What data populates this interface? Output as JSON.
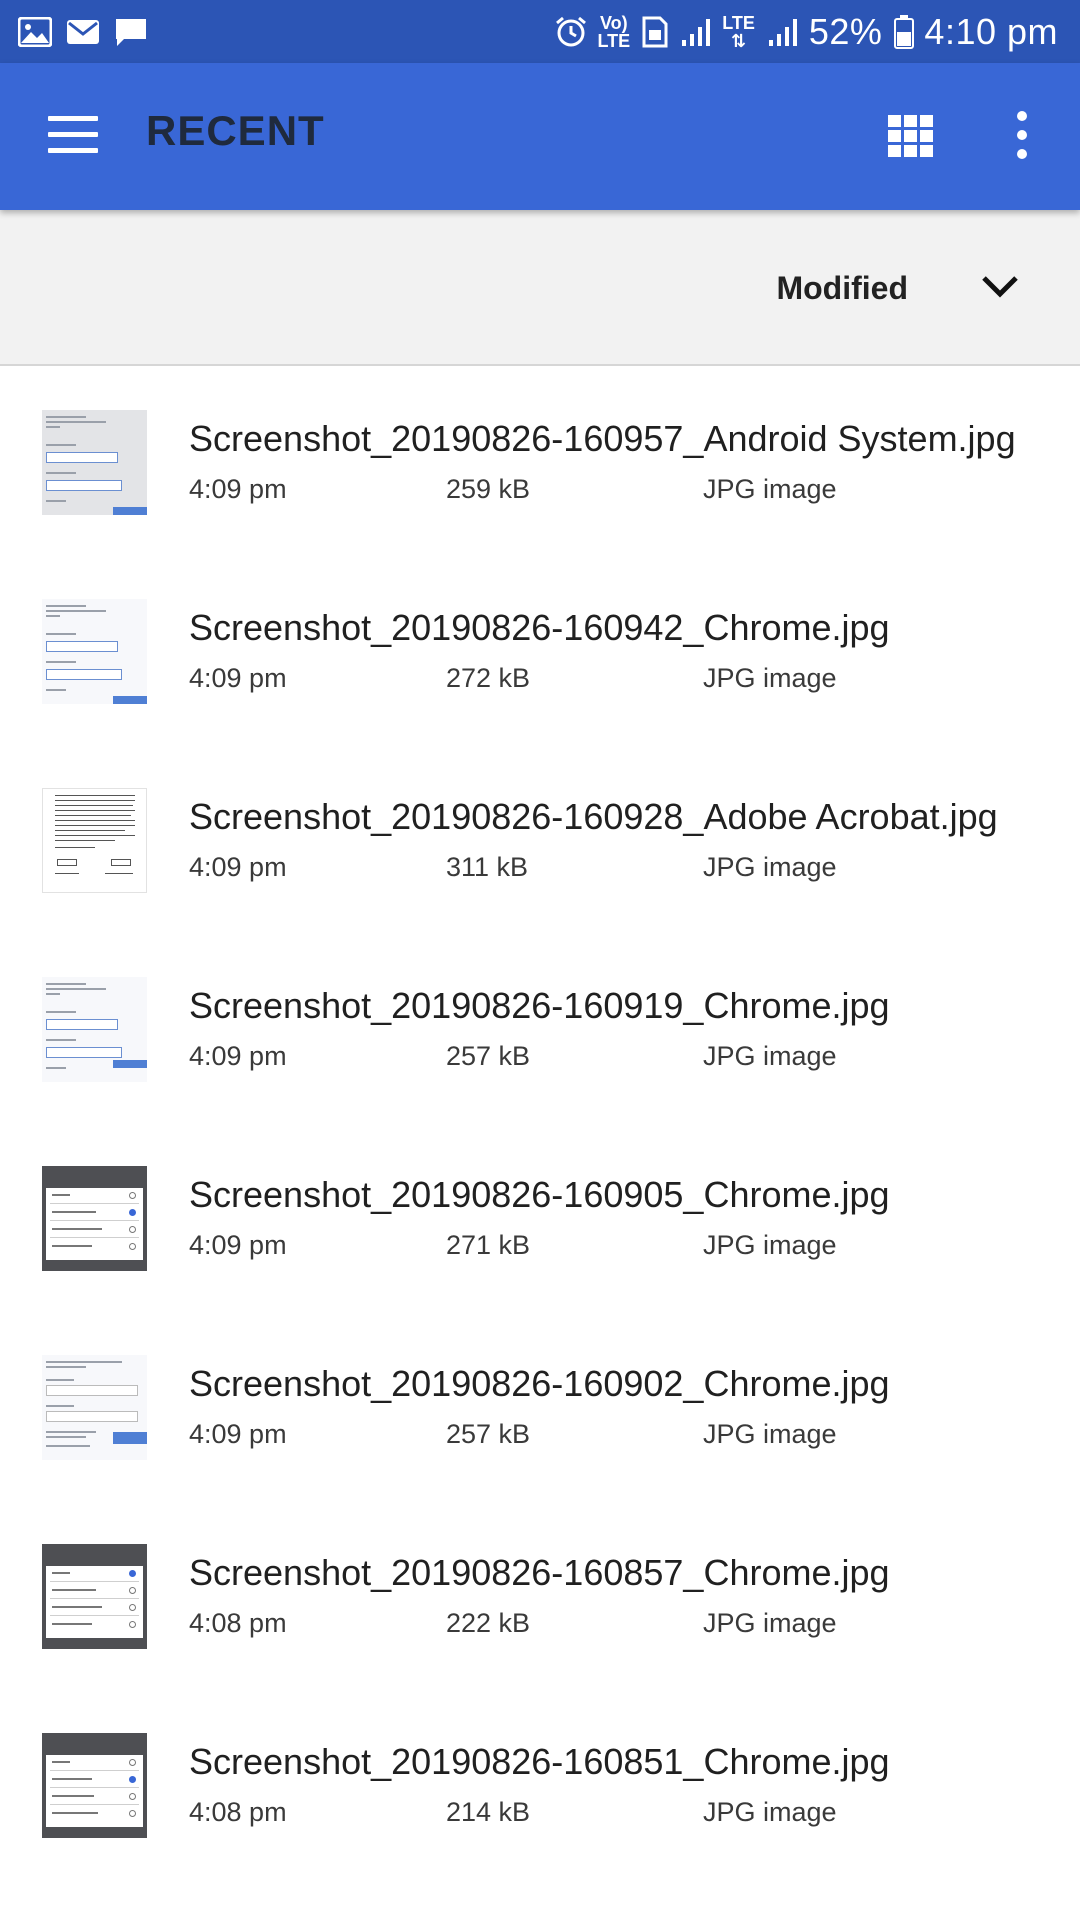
{
  "status_bar": {
    "battery": "52%",
    "time": "4:10 pm",
    "volte": "Vo)",
    "lte": "LTE",
    "lte_net": "LTE",
    "left_icons": [
      "gallery-icon",
      "email-icon",
      "chat-icon"
    ],
    "right_icons": [
      "alarm-icon",
      "volte-icon",
      "sim-icon",
      "signal-icon",
      "lte-icon",
      "signal-icon",
      "battery-icon"
    ]
  },
  "toolbar": {
    "title": "RECENT",
    "icons": [
      "menu-icon",
      "grid-view-icon",
      "more-vert-icon"
    ]
  },
  "sort": {
    "label": "Modified",
    "icon": "chevron-down-icon"
  },
  "colors": {
    "status_bar": "#2c55b5",
    "toolbar": "#3967d6",
    "sort_bar": "#f2f2f2",
    "title_text": "#1f2a3d"
  },
  "files": [
    {
      "name": "Screenshot_20190826-160957_Android System.jpg",
      "time": "4:09 pm",
      "size": "259 kB",
      "type": "JPG image"
    },
    {
      "name": "Screenshot_20190826-160942_Chrome.jpg",
      "time": "4:09 pm",
      "size": "272 kB",
      "type": "JPG image"
    },
    {
      "name": "Screenshot_20190826-160928_Adobe Acrobat.jpg",
      "time": "4:09 pm",
      "size": "311 kB",
      "type": "JPG image"
    },
    {
      "name": "Screenshot_20190826-160919_Chrome.jpg",
      "time": "4:09 pm",
      "size": "257 kB",
      "type": "JPG image"
    },
    {
      "name": "Screenshot_20190826-160905_Chrome.jpg",
      "time": "4:09 pm",
      "size": "271 kB",
      "type": "JPG image"
    },
    {
      "name": "Screenshot_20190826-160902_Chrome.jpg",
      "time": "4:09 pm",
      "size": "257 kB",
      "type": "JPG image"
    },
    {
      "name": "Screenshot_20190826-160857_Chrome.jpg",
      "time": "4:08 pm",
      "size": "222 kB",
      "type": "JPG image"
    },
    {
      "name": "Screenshot_20190826-160851_Chrome.jpg",
      "time": "4:08 pm",
      "size": "214 kB",
      "type": "JPG image"
    }
  ]
}
